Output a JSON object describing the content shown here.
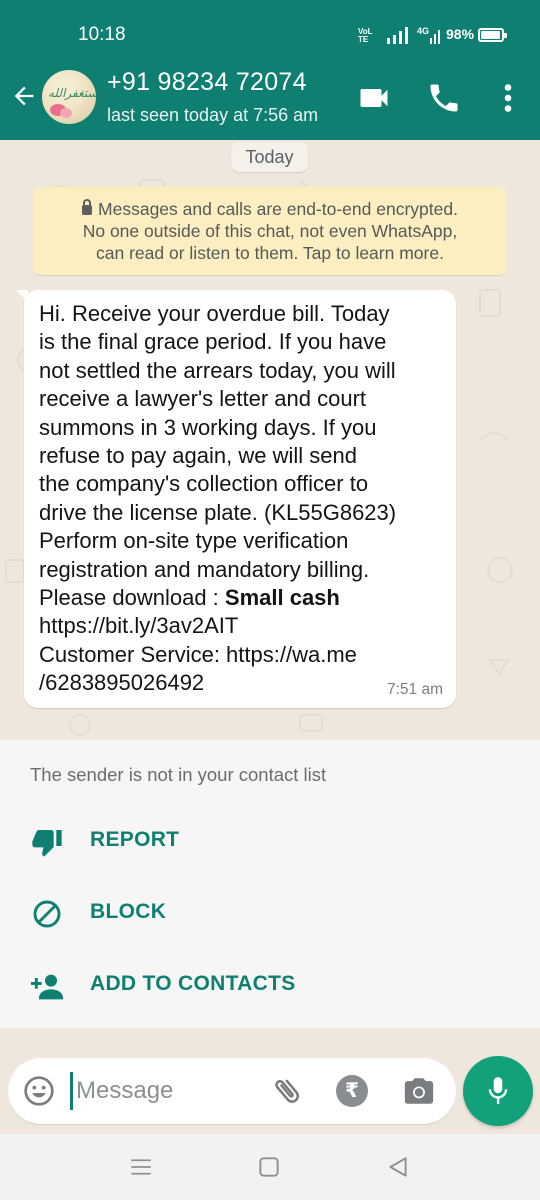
{
  "status_bar": {
    "time": "10:18",
    "network": "VoLTE",
    "network_type": "4G",
    "battery": "98%"
  },
  "header": {
    "contact_name": "+91 98234 72074",
    "last_seen": "last seen today at 7:56 am",
    "avatar_text": "استغفرالله",
    "icons": [
      "back-arrow-icon",
      "video-call-icon",
      "voice-call-icon",
      "more-vert-icon"
    ]
  },
  "chat": {
    "date_label": "Today",
    "encryption_notice": {
      "lines": [
        "Messages and calls are end-to-end encrypted.",
        "No one outside of this chat, not even WhatsApp,",
        "can read or listen to them. Tap to learn more."
      ]
    },
    "message": {
      "lines": [
        "Hi. Receive your overdue bill. Today",
        "is the final grace period. If you have",
        "not settled the arrears today, you will",
        "receive a lawyer's letter and court",
        "summons in 3 working days. If you",
        "refuse to pay again, we will send",
        "the company's collection officer to",
        "drive the license plate. (KL55G8623)",
        "Perform on-site type verification",
        "registration and mandatory billing."
      ],
      "download_prefix": "Please download : ",
      "download_app": "Small cash",
      "link": "https://bit.ly/3av2AIT",
      "customer_service_line": "Customer Service: https://wa.me",
      "customer_service_tail": "/6283895026492",
      "time": "7:51 am"
    }
  },
  "unknown_sender": {
    "note": "The sender is not in your contact list",
    "actions": [
      {
        "label": "REPORT",
        "icon": "thumbs-down-icon"
      },
      {
        "label": "BLOCK",
        "icon": "block-icon"
      },
      {
        "label": "ADD TO CONTACTS",
        "icon": "add-person-icon"
      }
    ]
  },
  "composer": {
    "placeholder": "Message",
    "currency_symbol": "₹",
    "icons": [
      "emoji-icon",
      "attach-icon",
      "rupee-icon",
      "camera-icon",
      "mic-icon"
    ]
  },
  "navbar": {
    "icons": [
      "menu-icon",
      "home-icon",
      "back-icon"
    ]
  },
  "colors": {
    "header": "#0f7f72",
    "accent": "#13a17c",
    "chat_bg": "#efe7dc",
    "encryption_bg": "#fbefc2"
  }
}
